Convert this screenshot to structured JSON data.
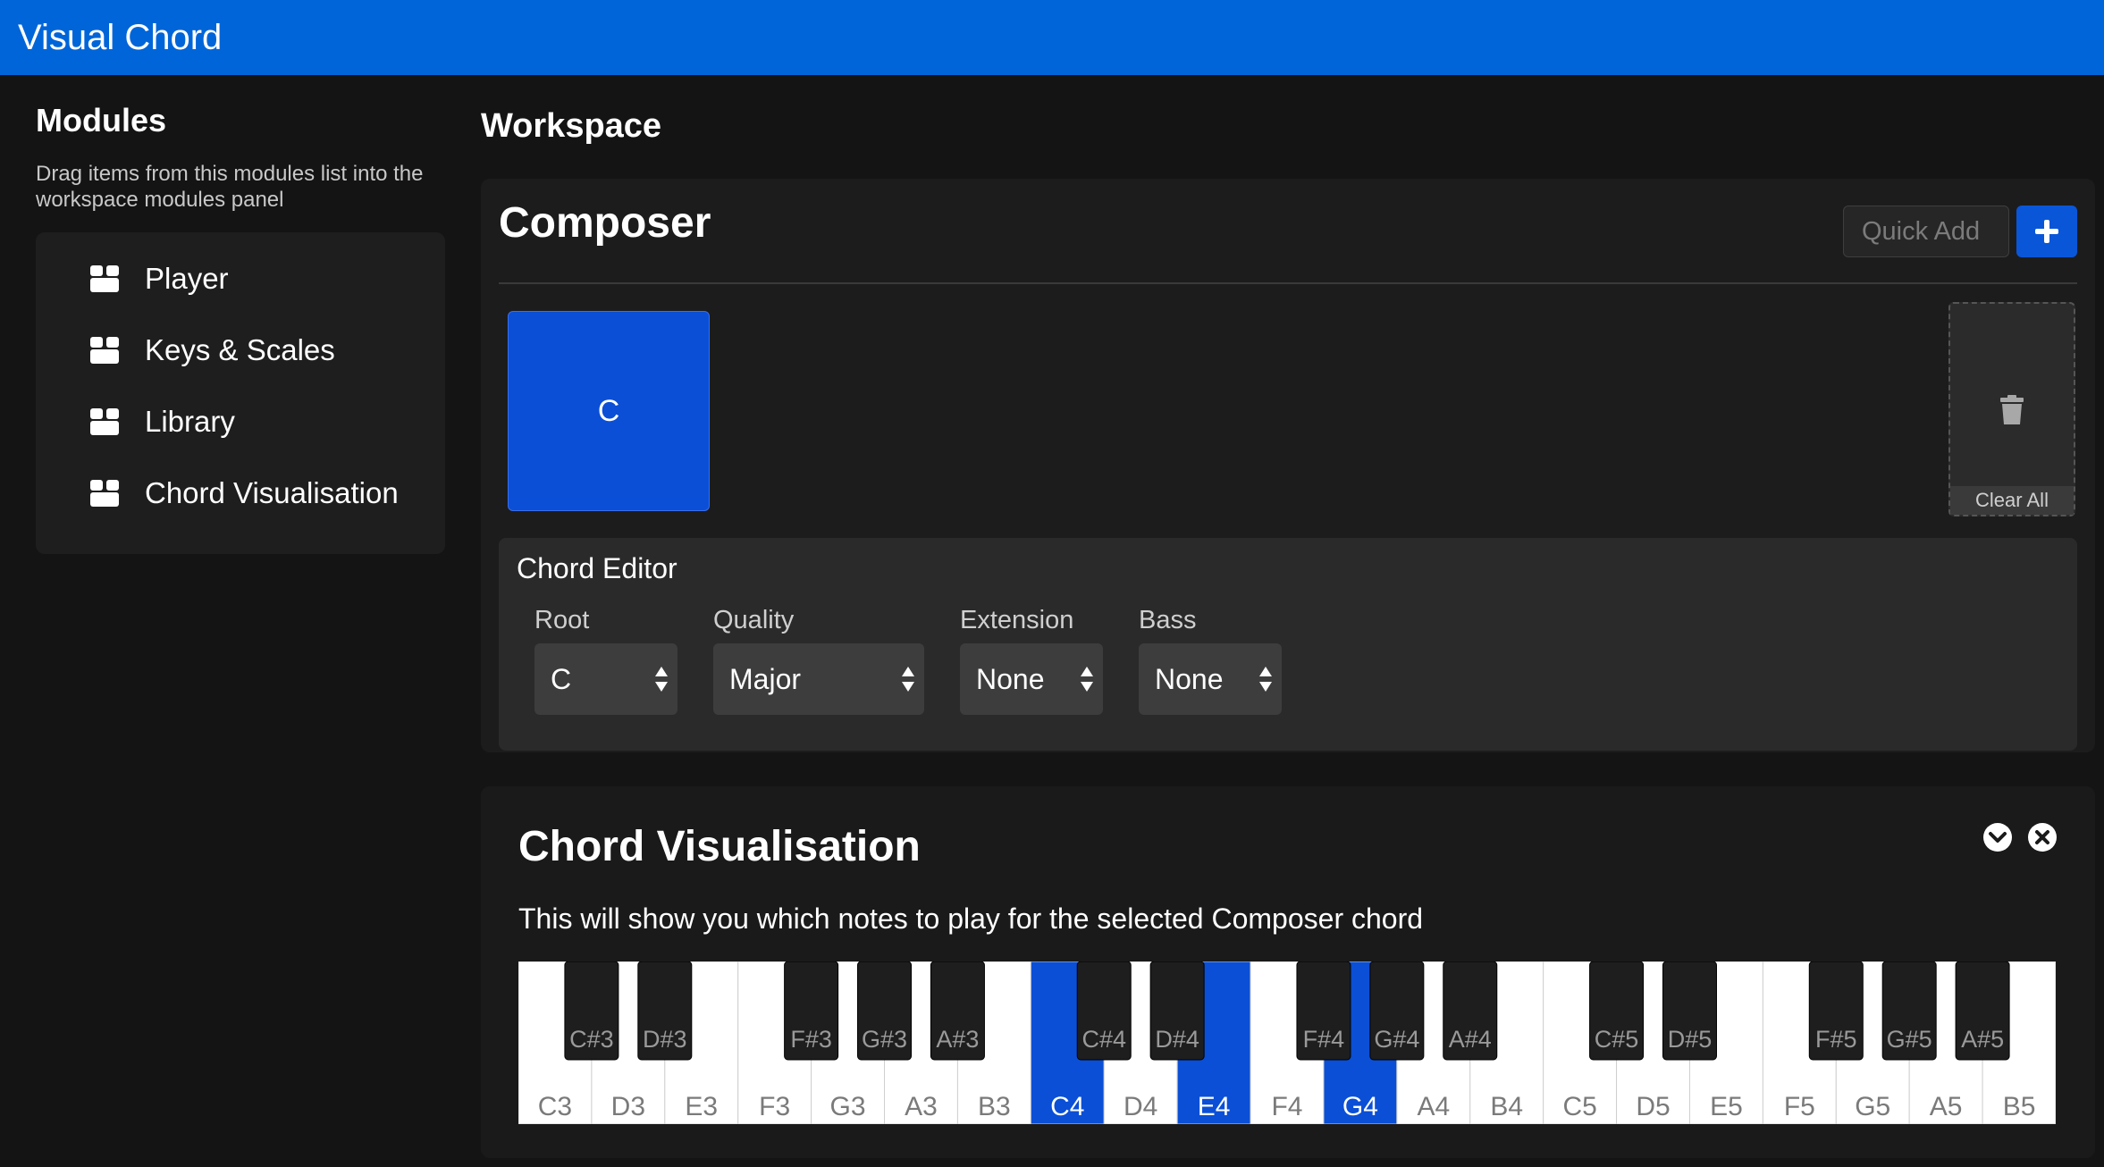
{
  "app": {
    "title": "Visual Chord"
  },
  "sidebar": {
    "title": "Modules",
    "description": "Drag items from this modules list into the workspace modules panel",
    "items": [
      {
        "label": "Player",
        "icon": "module-box-icon"
      },
      {
        "label": "Keys & Scales",
        "icon": "module-box-icon"
      },
      {
        "label": "Library",
        "icon": "module-box-icon"
      },
      {
        "label": "Chord Visualisation",
        "icon": "module-box-icon"
      }
    ]
  },
  "workspace": {
    "title": "Workspace",
    "composer": {
      "title": "Composer",
      "quick_add_placeholder": "Quick Add",
      "add_icon": "plus-icon",
      "chords": [
        "C"
      ],
      "clear_all_label": "Clear All",
      "clear_icon": "trash-icon",
      "editor": {
        "title": "Chord Editor",
        "fields": [
          {
            "label": "Root",
            "value": "C"
          },
          {
            "label": "Quality",
            "value": "Major"
          },
          {
            "label": "Extension",
            "value": "None"
          },
          {
            "label": "Bass",
            "value": "None"
          }
        ]
      }
    },
    "visualisation": {
      "title": "Chord Visualisation",
      "description": "This will show you which notes to play for the selected Composer chord",
      "collapse_icon": "chevron-down-icon",
      "close_icon": "close-icon",
      "white_keys": [
        "C3",
        "D3",
        "E3",
        "F3",
        "G3",
        "A3",
        "B3",
        "C4",
        "D4",
        "E4",
        "F4",
        "G4",
        "A4",
        "B4",
        "C5",
        "D5",
        "E5",
        "F5",
        "G5",
        "A5",
        "B5"
      ],
      "black_keys": [
        {
          "label": "C#3",
          "after": 0
        },
        {
          "label": "D#3",
          "after": 1
        },
        {
          "label": "F#3",
          "after": 3
        },
        {
          "label": "G#3",
          "after": 4
        },
        {
          "label": "A#3",
          "after": 5
        },
        {
          "label": "C#4",
          "after": 7
        },
        {
          "label": "D#4",
          "after": 8
        },
        {
          "label": "F#4",
          "after": 10
        },
        {
          "label": "G#4",
          "after": 11
        },
        {
          "label": "A#4",
          "after": 12
        },
        {
          "label": "C#5",
          "after": 14
        },
        {
          "label": "D#5",
          "after": 15
        },
        {
          "label": "F#5",
          "after": 17
        },
        {
          "label": "G#5",
          "after": 18
        },
        {
          "label": "A#5",
          "after": 19
        }
      ],
      "highlighted_notes": [
        "C4",
        "E4",
        "G4"
      ]
    }
  },
  "colors": {
    "accent": "#0065d8",
    "highlight": "#0a4fd6"
  }
}
